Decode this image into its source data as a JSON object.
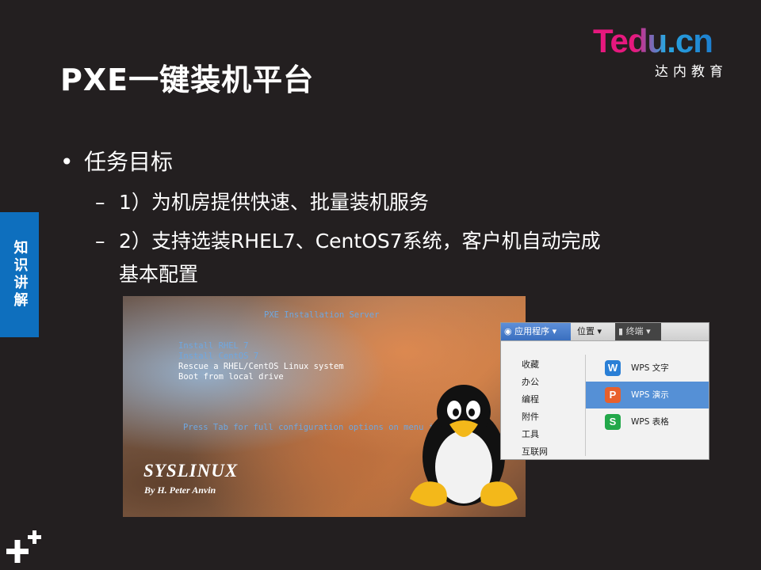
{
  "slide": {
    "title": "PXE一键装机平台",
    "side_tab": "知识讲解",
    "bullet": "任务目标",
    "sub1": "1）为机房提供快速、批量装机服务",
    "sub2_line1": "2）支持选装RHEL7、CentOS7系统，客户机自动完成",
    "sub2_line2": "基本配置",
    "bullet_symbol": "•",
    "dash_symbol": "–"
  },
  "logo": {
    "word": "Tedu.cn",
    "sub": "达内教育"
  },
  "boot_screen": {
    "header": "PXE Installation Server",
    "items": [
      "Install RHEL 7",
      "Install CentOS 7",
      "Rescue a RHEL/CentOS Linux system",
      "Boot from local drive"
    ],
    "hint": "Press Tab for full configuration options on menu items.",
    "brand": "SYSLINUX",
    "author": "By H. Peter Anvin"
  },
  "desktop_menu": {
    "apps_label": "应用程序",
    "places_label": "位置",
    "terminal_label": "终端",
    "categories": [
      "收藏",
      "办公",
      "编程",
      "附件",
      "工具",
      "互联网"
    ],
    "apps": [
      {
        "label": "WPS 文字",
        "icon": "W",
        "color": "#2a7fd6"
      },
      {
        "label": "WPS 演示",
        "icon": "P",
        "color": "#e8602c"
      },
      {
        "label": "WPS 表格",
        "icon": "S",
        "color": "#22a84a"
      }
    ]
  }
}
